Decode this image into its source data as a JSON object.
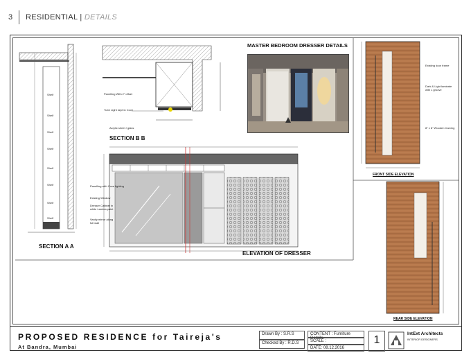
{
  "header": {
    "page_number": "3",
    "section": "RESIDENTIAL",
    "subsection": "DETAILS"
  },
  "drawing": {
    "section_aa_title": "SECTION A A",
    "section_bb_title": "SECTION B B",
    "photo_title": "MASTER BEDROOM DRESSER DETAILS",
    "elevation_title": "ELEVATION OF DRESSER",
    "front_title": "FRONT SIDE ELEVATION",
    "rear_title": "REAR SIDE ELEVATION",
    "shelf_label": "Shelf",
    "bb_notes": [
      "Panelling With 2\" offset",
      "Tube Light kept in Cove",
      "Acrylic sheet / glass"
    ],
    "elev_notes": [
      "Panelling with Cove lighting",
      "Existing Window",
      "Dresser Cabinet in white Lamina paint",
      "Vanity mirror along full wall"
    ],
    "front_notes": [
      "Existing door frame",
      "Dark & Light laminate with L groove",
      "8\" x 8\" Wooden Carving"
    ]
  },
  "title_block": {
    "project": "PROPOSED RESIDENCE for Taireja's",
    "location": "At Bandra, Mumbai",
    "drawn_by": "Drawn By : S.R.S",
    "checked_by": "Checked By : R.D.S",
    "content": "CONTENT : Furniture Details",
    "scale": "SCALE :",
    "date": "DATE: 08.12.2016",
    "sheet_no": "1",
    "firm": "IntExt Architects",
    "firm_sub": "INTERIOR DESIGNERS"
  }
}
